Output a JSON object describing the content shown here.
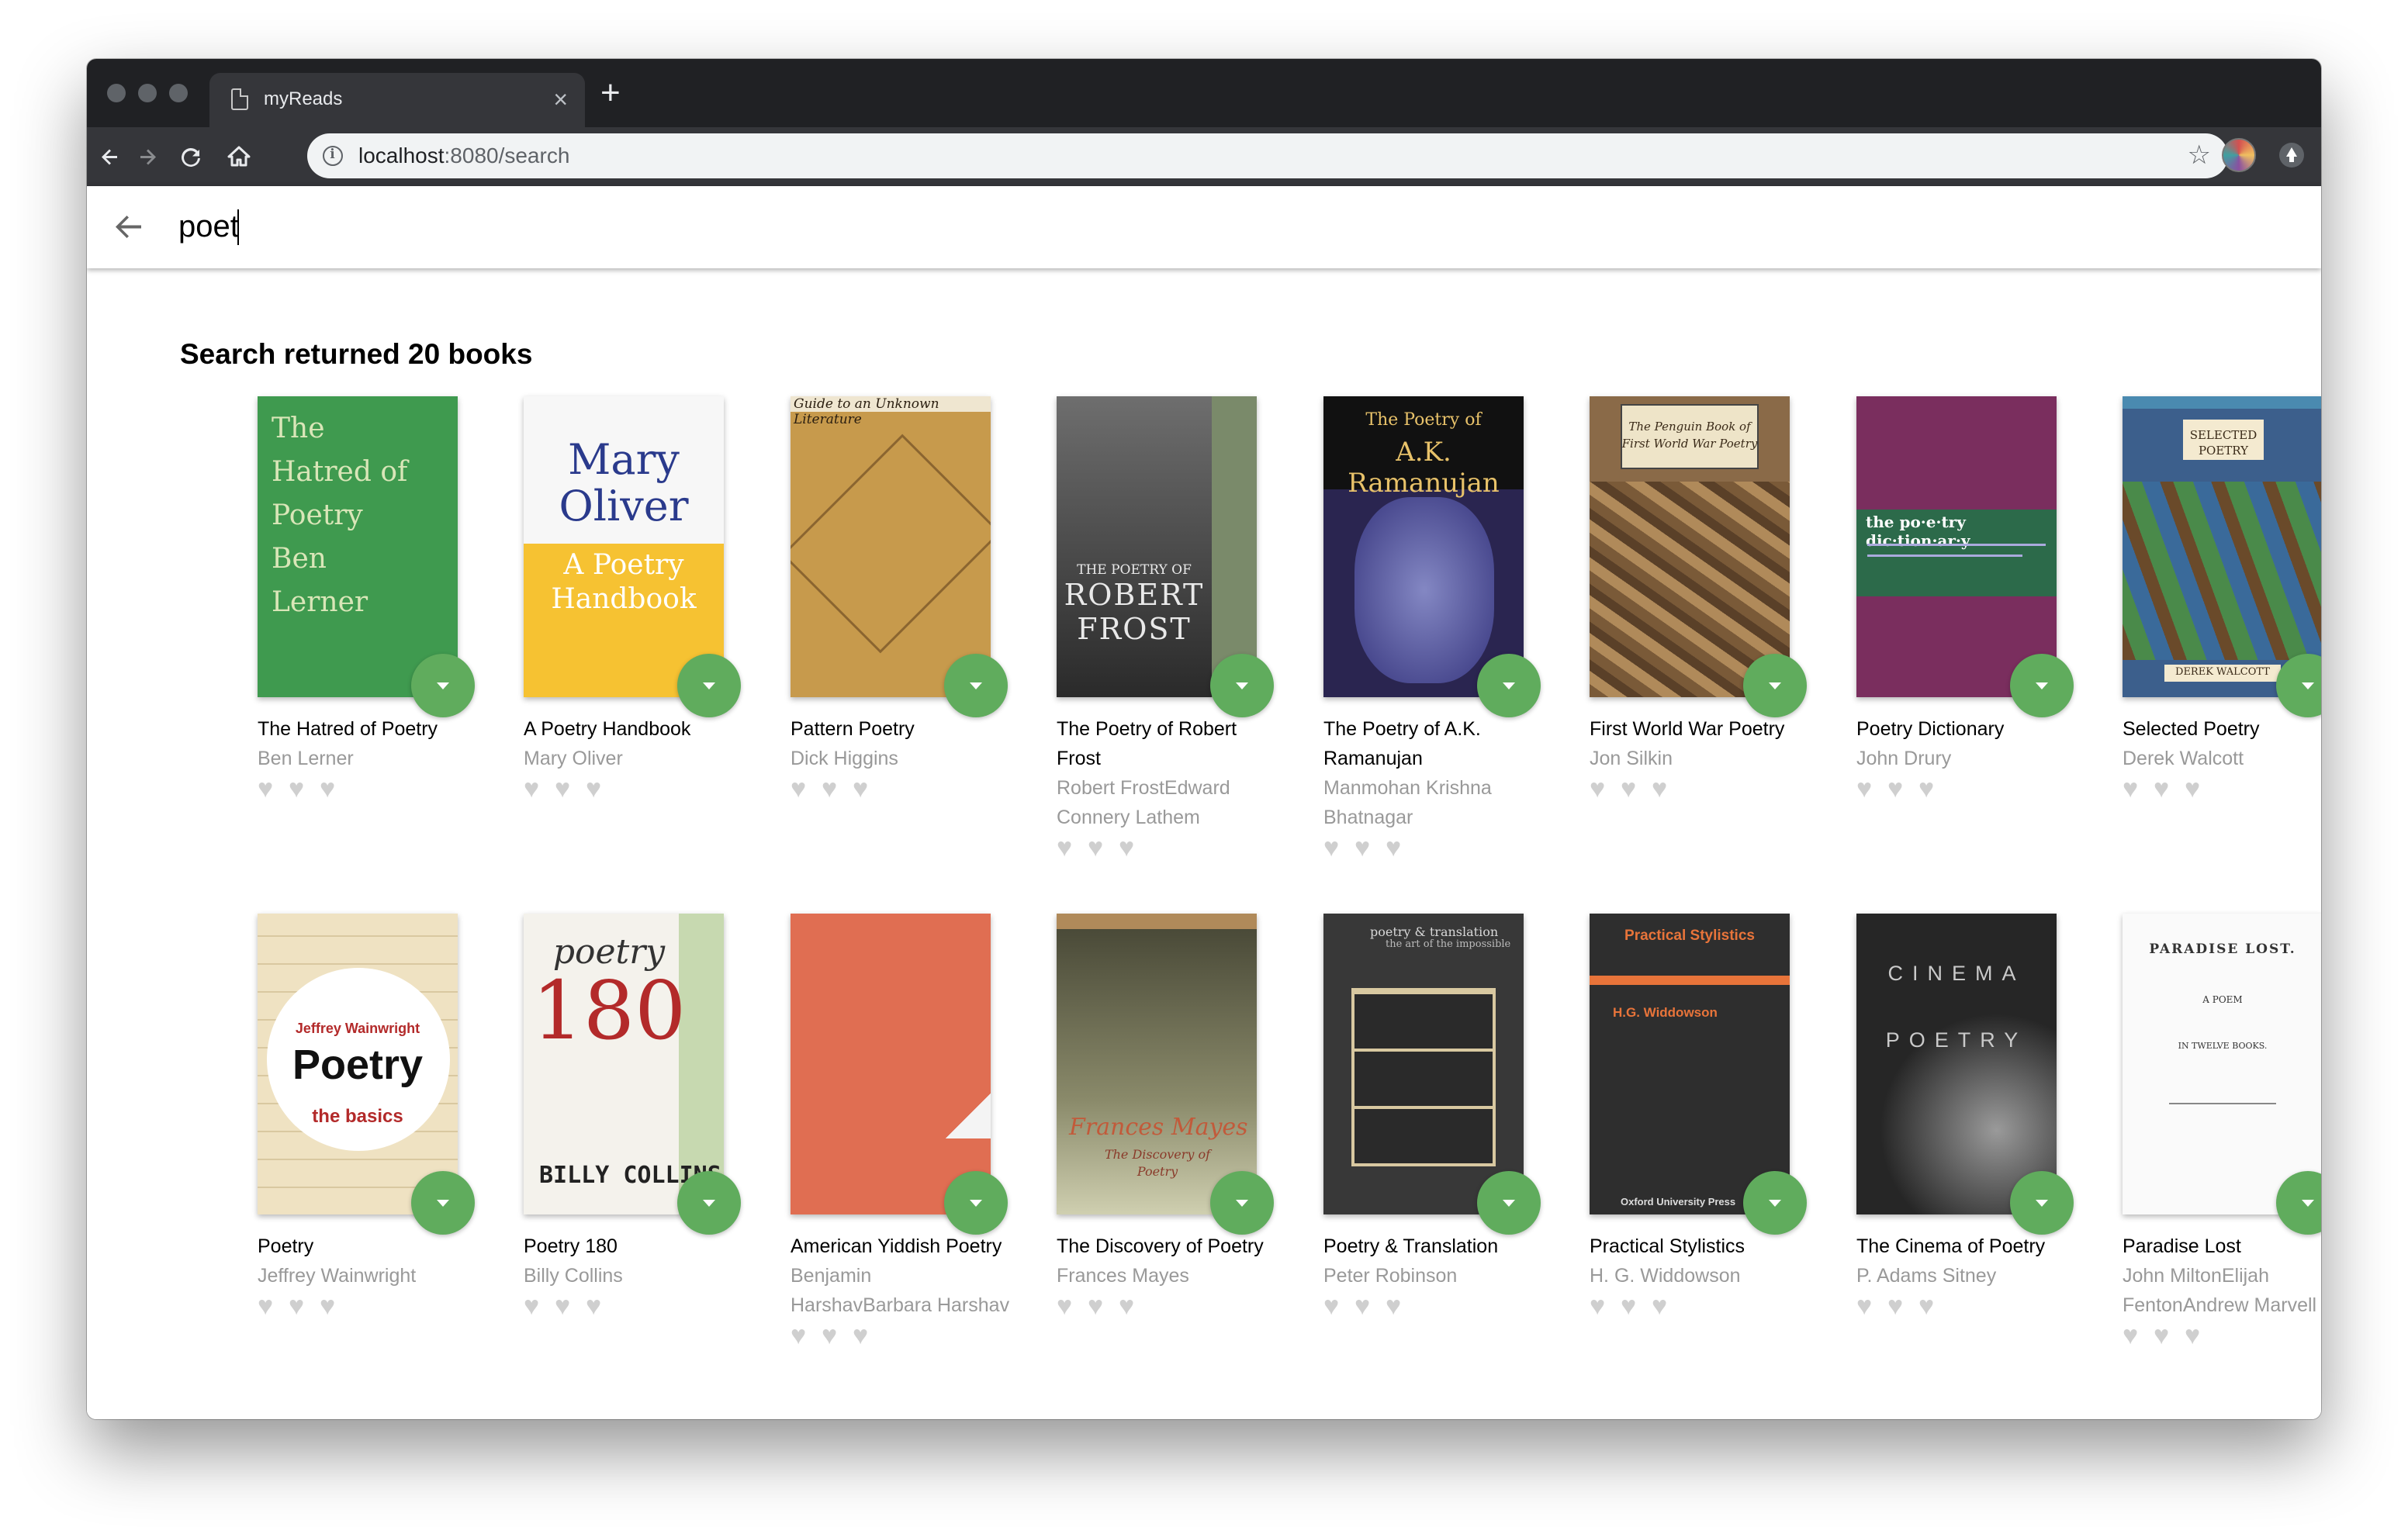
{
  "browser": {
    "tab_title": "myReads",
    "tab_close": "×",
    "new_tab": "+",
    "url_host": "localhost",
    "url_path": ":8080/search",
    "star": "☆"
  },
  "search": {
    "value": "poet"
  },
  "results": {
    "heading": "Search returned 20 books"
  },
  "books": [
    {
      "title": "The Hatred of Poetry",
      "authors": "Ben Lerner",
      "cover": {
        "bg": "#3f9a4f",
        "lines": [
          "The",
          "Hatred of",
          "Poetry",
          "Ben",
          "Lerner"
        ],
        "color": "#d9e6b8"
      }
    },
    {
      "title": "A Poetry Handbook",
      "authors": "Mary Oliver",
      "cover": {
        "bg": "#f7f7f7",
        "lines": [
          "Mary",
          "Oliver",
          "A Poetry",
          "Handbook"
        ],
        "color": "#2a3a8c"
      }
    },
    {
      "title": "Pattern Poetry",
      "authors": "Dick Higgins",
      "cover": {
        "bg": "#c79a4c",
        "lines": [
          "Guide to an Unknown Literature"
        ],
        "color": "#2a1e10"
      }
    },
    {
      "title": "The Poetry of Robert Frost",
      "authors": "Robert FrostEdward Connery Lathem",
      "cover": {
        "bg": "#3b3b3b",
        "lines": [
          "THE POETRY OF",
          "ROBERT",
          "FROST"
        ],
        "color": "#e9e9e9"
      }
    },
    {
      "title": "The Poetry of A.K. Ramanujan",
      "authors": "Manmohan Krishna Bhatnagar",
      "cover": {
        "bg": "#2a2550",
        "lines": [
          "The Poetry of",
          "A.K. Ramanujan"
        ],
        "color": "#e8c26a"
      }
    },
    {
      "title": "First World War Poetry",
      "authors": "Jon Silkin",
      "cover": {
        "bg": "#8a6a48",
        "lines": [
          "The Penguin Book of",
          "First World War Poetry"
        ],
        "color": "#3a2a18"
      }
    },
    {
      "title": "Poetry Dictionary",
      "authors": "John Drury",
      "cover": {
        "bg": "#7a2e5e",
        "lines": [
          "the po·e·try dic·tion·ar·y"
        ],
        "color": "#ffffff"
      }
    },
    {
      "title": "Selected Poetry",
      "authors": "Derek Walcott",
      "cover": {
        "bg": "#3c5f8c",
        "lines": [
          "SELECTED",
          "POETRY",
          "DEREK WALCOTT"
        ],
        "color": "#3a2a18"
      }
    },
    {
      "title": "Poetry",
      "authors": "Jeffrey Wainwright",
      "cover": {
        "bg": "#efe2c2",
        "lines": [
          "Jeffrey Wainwright",
          "Poetry",
          "the basics"
        ],
        "color": "#111111"
      }
    },
    {
      "title": "Poetry 180",
      "authors": "Billy Collins",
      "cover": {
        "bg": "#f4f2ec",
        "lines": [
          "poetry",
          "180",
          "BILLY COLLINS"
        ],
        "color": "#b32a2a"
      }
    },
    {
      "title": "American Yiddish Poetry",
      "authors": "Benjamin HarshavBarbara Harshav",
      "cover": {
        "bg": "#e06e52",
        "lines": [],
        "color": "#ffffff"
      }
    },
    {
      "title": "The Discovery of Poetry",
      "authors": "Frances Mayes",
      "cover": {
        "bg": "#6a6a50",
        "lines": [
          "Frances Mayes",
          "The Discovery of Poetry"
        ],
        "color": "#c25a3a"
      }
    },
    {
      "title": "Poetry & Translation",
      "authors": "Peter Robinson",
      "cover": {
        "bg": "#383838",
        "lines": [
          "poetry & translation",
          "the art of the impossible"
        ],
        "color": "#d8d8d8"
      }
    },
    {
      "title": "Practical Stylistics",
      "authors": "H. G. Widdowson",
      "cover": {
        "bg": "#2e2e2e",
        "lines": [
          "Practical Stylistics",
          "H.G. Widdowson",
          "Oxford University Press"
        ],
        "color": "#e8743a"
      }
    },
    {
      "title": "The Cinema of Poetry",
      "authors": "P. Adams Sitney",
      "cover": {
        "bg": "#262626",
        "lines": [
          "CINEMA",
          "POETRY"
        ],
        "color": "#c9c9c9"
      }
    },
    {
      "title": "Paradise Lost",
      "authors": "John MiltonElijah FentonAndrew Marvell",
      "cover": {
        "bg": "#fafafa",
        "lines": [
          "PARADISE LOST.",
          "A POEM",
          "IN TWELVE BOOKS."
        ],
        "color": "#333333"
      }
    }
  ]
}
